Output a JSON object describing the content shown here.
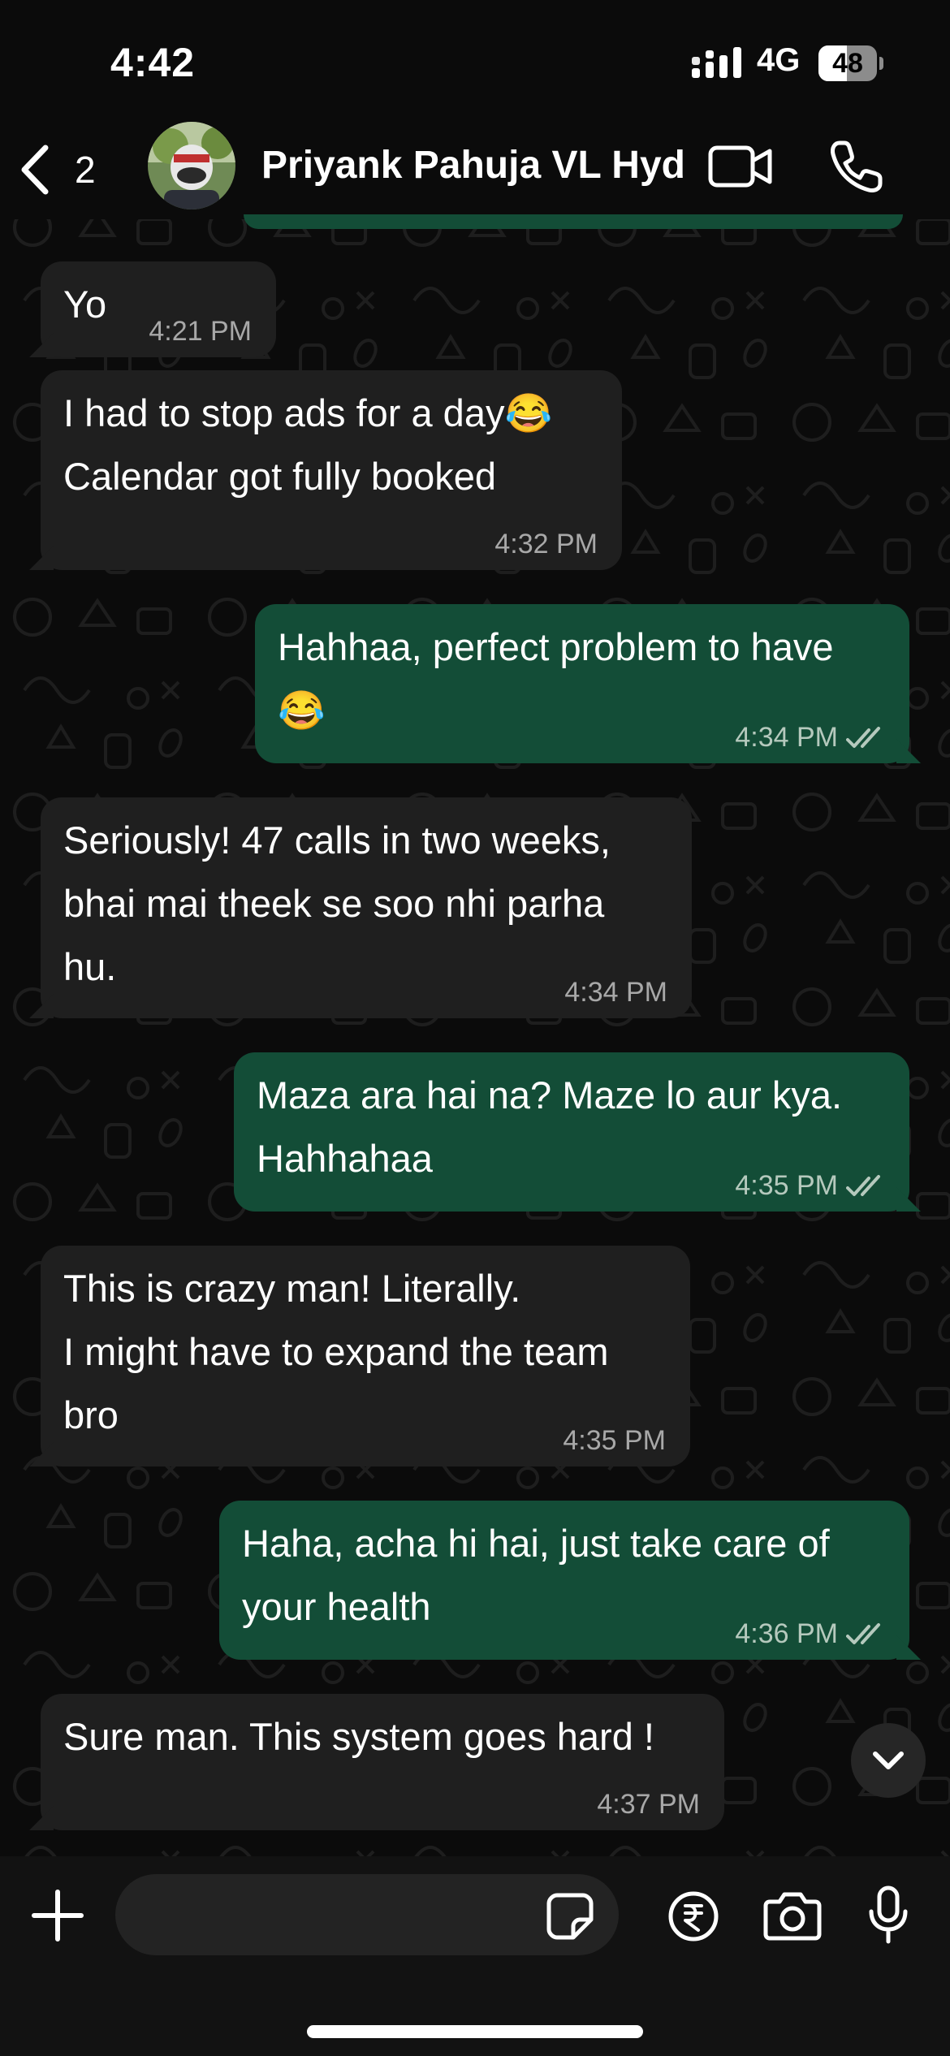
{
  "status_bar": {
    "time": "4:42",
    "network": "4G",
    "battery": "48",
    "battery_level": 0.48
  },
  "header": {
    "back_count": "2",
    "contact_name": "Priyank Pahuja VL Hyd",
    "icons": [
      "chevron-left-icon",
      "video-call-icon",
      "phone-icon"
    ]
  },
  "messages": [
    {
      "direction": "incoming",
      "lines": [
        "Yo"
      ],
      "time": "4:21 PM"
    },
    {
      "direction": "incoming",
      "lines": [
        "I had to stop ads for a day😂",
        "Calendar got fully booked"
      ],
      "time": "4:32 PM"
    },
    {
      "direction": "outgoing",
      "lines": [
        "Hahhaa, perfect problem to have",
        "😂"
      ],
      "time": "4:34 PM",
      "status": "read"
    },
    {
      "direction": "incoming",
      "lines": [
        "Seriously! 47 calls in two weeks,",
        "bhai mai theek se soo nhi parha",
        "hu."
      ],
      "time": "4:34 PM"
    },
    {
      "direction": "outgoing",
      "lines": [
        "Maza ara hai na? Maze lo aur kya.",
        "Hahhahaa"
      ],
      "time": "4:35 PM",
      "status": "read"
    },
    {
      "direction": "incoming",
      "lines": [
        "This is crazy man! Literally.",
        "I might have to expand the team",
        "bro"
      ],
      "time": "4:35 PM"
    },
    {
      "direction": "outgoing",
      "lines": [
        "Haha, acha hi hai, just take care of",
        "your health"
      ],
      "time": "4:36 PM",
      "status": "read"
    },
    {
      "direction": "incoming",
      "lines": [
        "Sure man. This system goes hard !"
      ],
      "time": "4:37 PM"
    }
  ],
  "composer": {
    "placeholder": "",
    "value": ""
  },
  "colors": {
    "background": "#0b0b0b",
    "incoming_bubble": "#1f1f1f",
    "outgoing_bubble": "#134d37",
    "timestamp": "#a8a8a8"
  }
}
